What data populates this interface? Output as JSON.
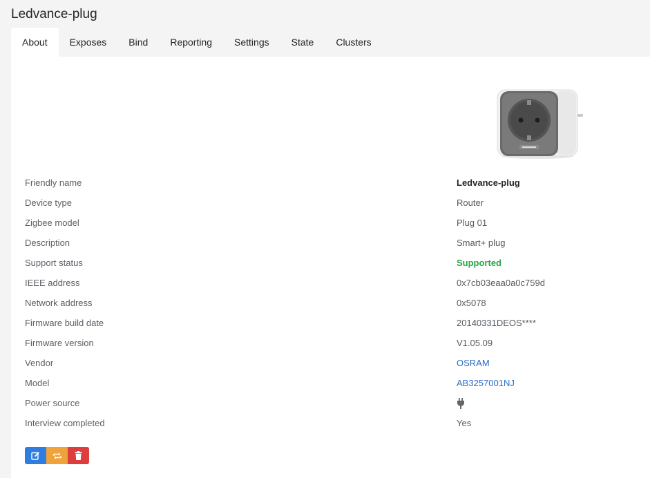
{
  "page": {
    "title": "Ledvance-plug"
  },
  "tabs": [
    {
      "label": "About",
      "active": true
    },
    {
      "label": "Exposes"
    },
    {
      "label": "Bind"
    },
    {
      "label": "Reporting"
    },
    {
      "label": "Settings"
    },
    {
      "label": "State"
    },
    {
      "label": "Clusters"
    }
  ],
  "device_info": {
    "friendly_name": {
      "label": "Friendly name",
      "value": "Ledvance-plug"
    },
    "device_type": {
      "label": "Device type",
      "value": "Router"
    },
    "zigbee_model": {
      "label": "Zigbee model",
      "value": "Plug 01"
    },
    "description": {
      "label": "Description",
      "value": "Smart+ plug"
    },
    "support_status": {
      "label": "Support status",
      "value": "Supported"
    },
    "ieee_address": {
      "label": "IEEE address",
      "value": "0x7cb03eaa0a0c759d"
    },
    "network_address": {
      "label": "Network address",
      "value": "0x5078"
    },
    "firmware_build_date": {
      "label": "Firmware build date",
      "value": "20140331DEOS****"
    },
    "firmware_version": {
      "label": "Firmware version",
      "value": "V1.05.09"
    },
    "vendor": {
      "label": "Vendor",
      "value": "OSRAM"
    },
    "model": {
      "label": "Model",
      "value": "AB3257001NJ"
    },
    "power_source": {
      "label": "Power source",
      "icon": "plug-icon"
    },
    "interview_completed": {
      "label": "Interview completed",
      "value": "Yes"
    }
  },
  "actions": {
    "rename_icon": "edit-icon",
    "reconfigure_icon": "refresh-icon",
    "remove_icon": "trash-icon"
  },
  "colors": {
    "success": "#28a745",
    "link": "#2b6cc4",
    "primary": "#2f7de1",
    "warning": "#f0a33a",
    "danger": "#dc3d3d"
  }
}
